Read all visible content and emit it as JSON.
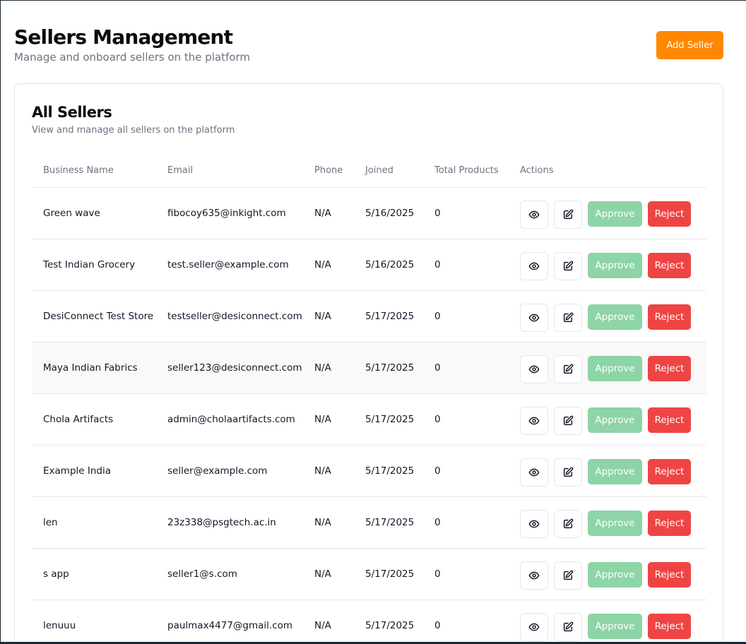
{
  "header": {
    "title": "Sellers Management",
    "subtitle": "Manage and onboard sellers on the platform",
    "add_button_label": "Add Seller"
  },
  "card": {
    "title": "All Sellers",
    "subtitle": "View and manage all sellers on the platform"
  },
  "table": {
    "columns": [
      "Business Name",
      "Email",
      "Phone",
      "Joined",
      "Total Products",
      "Actions"
    ],
    "rows": [
      {
        "business_name": "Green wave",
        "email": "fibocoy635@inkight.com",
        "phone": "N/A",
        "joined": "5/16/2025",
        "total_products": "0",
        "approve_label": "Approve",
        "reject_label": "Reject"
      },
      {
        "business_name": "Test Indian Grocery",
        "email": "test.seller@example.com",
        "phone": "N/A",
        "joined": "5/16/2025",
        "total_products": "0",
        "approve_label": "Approve",
        "reject_label": "Reject"
      },
      {
        "business_name": "DesiConnect Test Store",
        "email": "testseller@desiconnect.com",
        "phone": "N/A",
        "joined": "5/17/2025",
        "total_products": "0",
        "approve_label": "Approve",
        "reject_label": "Reject"
      },
      {
        "business_name": "Maya Indian Fabrics",
        "email": "seller123@desiconnect.com",
        "phone": "N/A",
        "joined": "5/17/2025",
        "total_products": "0",
        "approve_label": "Approve",
        "reject_label": "Reject"
      },
      {
        "business_name": "Chola Artifacts",
        "email": "admin@cholaartifacts.com",
        "phone": "N/A",
        "joined": "5/17/2025",
        "total_products": "0",
        "approve_label": "Approve",
        "reject_label": "Reject"
      },
      {
        "business_name": "Example India",
        "email": "seller@example.com",
        "phone": "N/A",
        "joined": "5/17/2025",
        "total_products": "0",
        "approve_label": "Approve",
        "reject_label": "Reject"
      },
      {
        "business_name": "len",
        "email": "23z338@psgtech.ac.in",
        "phone": "N/A",
        "joined": "5/17/2025",
        "total_products": "0",
        "approve_label": "Approve",
        "reject_label": "Reject"
      },
      {
        "business_name": "s app",
        "email": "seller1@s.com",
        "phone": "N/A",
        "joined": "5/17/2025",
        "total_products": "0",
        "approve_label": "Approve",
        "reject_label": "Reject"
      },
      {
        "business_name": "lenuuu",
        "email": "paulmax4477@gmail.com",
        "phone": "N/A",
        "joined": "5/17/2025",
        "total_products": "0",
        "approve_label": "Approve",
        "reject_label": "Reject"
      }
    ]
  },
  "colors": {
    "accent": "#ff8800",
    "approve": "#8dd4a6",
    "reject": "#ef4444"
  },
  "icons": {
    "view": "eye-icon",
    "edit": "edit-icon"
  }
}
